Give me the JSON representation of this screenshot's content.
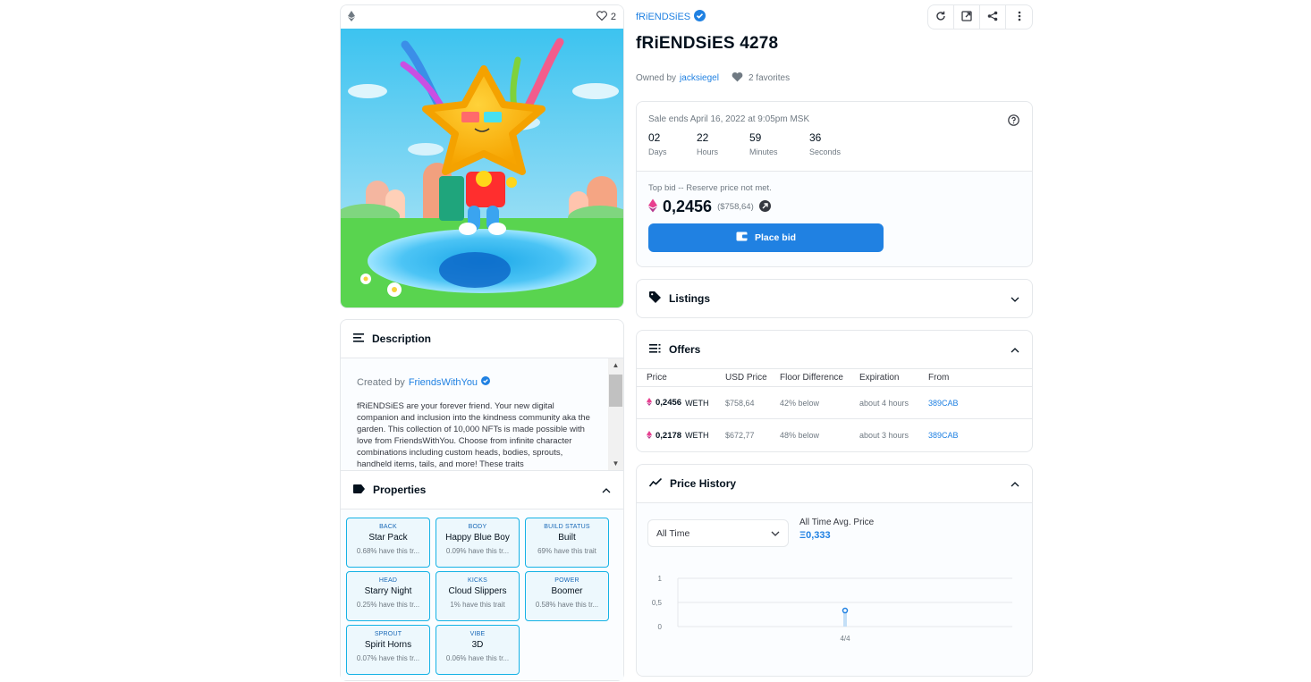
{
  "image_card": {
    "favorites_count": "2"
  },
  "description": {
    "title": "Description",
    "created_by_label": "Created by",
    "creator": "FriendsWithYou",
    "text": "fRiENDSiES are your forever friend. Your new digital companion and inclusion into the kindness community aka the garden. This collection of 10,000 NFTs is made possible with love from FriendsWithYou. Choose from infinite character combinations including custom heads, bodies, sprouts, handheld items, tails, and more! These traits"
  },
  "properties": {
    "title": "Properties",
    "items": [
      {
        "type": "BACK",
        "value": "Star Pack",
        "rarity": "0.68% have this tr..."
      },
      {
        "type": "BODY",
        "value": "Happy Blue Boy",
        "rarity": "0.09% have this tr..."
      },
      {
        "type": "BUILD STATUS",
        "value": "Built",
        "rarity": "69% have this trait"
      },
      {
        "type": "HEAD",
        "value": "Starry Night",
        "rarity": "0.25% have this tr..."
      },
      {
        "type": "KICKS",
        "value": "Cloud Slippers",
        "rarity": "1% have this trait"
      },
      {
        "type": "POWER",
        "value": "Boomer",
        "rarity": "0.58% have this tr..."
      },
      {
        "type": "SPROUT",
        "value": "Spirit Horns",
        "rarity": "0.07% have this tr..."
      },
      {
        "type": "VIBE",
        "value": "3D",
        "rarity": "0.06% have this tr..."
      }
    ]
  },
  "header": {
    "collection": "fRiENDSiES",
    "title": "fRiENDSiES 4278",
    "owned_by_label": "Owned by",
    "owner": "jacksiegel",
    "favorites": "2 favorites"
  },
  "sale": {
    "ends": "Sale ends April 16, 2022 at 9:05pm MSK",
    "countdown": [
      {
        "value": "02",
        "label": "Days"
      },
      {
        "value": "22",
        "label": "Hours"
      },
      {
        "value": "59",
        "label": "Minutes"
      },
      {
        "value": "36",
        "label": "Seconds"
      }
    ],
    "top_bid_label": "Top bid -- Reserve price not met.",
    "price": "0,2456",
    "price_usd": "($758,64)",
    "place_bid": "Place bid"
  },
  "listings": {
    "title": "Listings"
  },
  "offers": {
    "title": "Offers",
    "columns": [
      "Price",
      "USD Price",
      "Floor Difference",
      "Expiration",
      "From"
    ],
    "rows": [
      {
        "price": "0,2456",
        "currency": "WETH",
        "usd": "$758,64",
        "floor": "42% below",
        "expiration": "about 4 hours",
        "from": "389CAB"
      },
      {
        "price": "0,2178",
        "currency": "WETH",
        "usd": "$672,77",
        "floor": "48% below",
        "expiration": "about 3 hours",
        "from": "389CAB"
      }
    ]
  },
  "price_history": {
    "title": "Price History",
    "range": "All Time",
    "avg_label": "All Time Avg. Price",
    "avg_value": "Ξ0,333"
  },
  "chart_data": {
    "type": "scatter",
    "categories": [
      "4/4"
    ],
    "values": [
      0.333
    ],
    "ylim": [
      0,
      1
    ],
    "yticks": [
      "1",
      "0,5",
      "0"
    ],
    "grid": true
  },
  "colors": {
    "accent": "#2081e2",
    "trait_border": "#15b2e5",
    "eth": "#8a45a0"
  }
}
